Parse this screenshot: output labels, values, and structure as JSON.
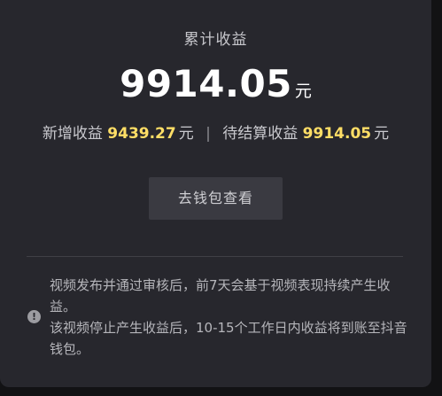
{
  "earnings": {
    "title": "累计收益",
    "total_amount": "9914.05",
    "total_unit": "元",
    "new_label": "新增收益",
    "new_amount": "9439.27",
    "new_unit": "元",
    "separator": "|",
    "pending_label": "待结算收益",
    "pending_amount": "9914.05",
    "pending_unit": "元"
  },
  "wallet_button": {
    "label": "去钱包查看"
  },
  "notice": {
    "icon": "info-icon",
    "line1": "视频发布并通过审核后，前7天会基于视频表现持续产生收益。",
    "line2": "该视频停止产生收益后，10-15个工作日内收益将到账至抖音钱包。"
  },
  "colors": {
    "background": "#121214",
    "panel": "#27272d",
    "highlight": "#ffde66",
    "button": "#3a3a41"
  }
}
